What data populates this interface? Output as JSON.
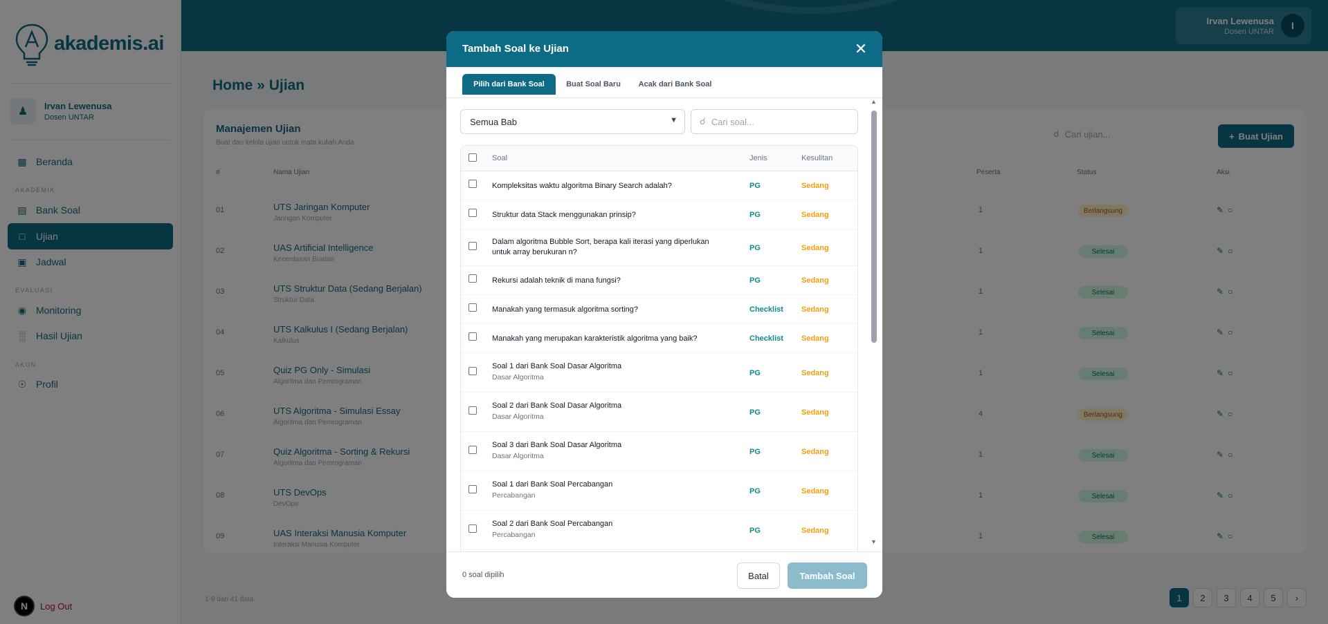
{
  "brand": {
    "name": "akademis.ai"
  },
  "sidebar": {
    "user": {
      "name": "Irvan Lewenusa",
      "role": "Dosen UNTAR"
    },
    "items": [
      {
        "label": "Beranda",
        "icon": "grid-icon"
      },
      {
        "section": "AKADEMIK"
      },
      {
        "label": "Bank Soal",
        "icon": "book-icon"
      },
      {
        "label": "Ujian",
        "icon": "clipboard-icon",
        "active": true
      },
      {
        "label": "Jadwal",
        "icon": "calendar-icon"
      },
      {
        "section": "EVALUASI"
      },
      {
        "label": "Monitoring",
        "icon": "eye-icon"
      },
      {
        "label": "Hasil Ujian",
        "icon": "bar-chart-icon"
      },
      {
        "section": "AKUN"
      },
      {
        "label": "Profil",
        "icon": "user-circle-icon"
      }
    ],
    "logout": "Log Out",
    "dev_badge": "N"
  },
  "topbar": {
    "user_name": "Irvan Lewenusa",
    "user_role": "Dosen UNTAR",
    "avatar_initial": "I"
  },
  "page": {
    "breadcrumb": "Home » Ujian",
    "card_title": "Manajemen Ujian",
    "card_subtitle": "Buat dan kelola ujian untuk mata kuliah Anda",
    "search_placeholder": "Cari ujian...",
    "create_button": "Buat Ujian",
    "columns": [
      "#",
      "Nama Ujian",
      "Peserta",
      "Status",
      "Aksi"
    ],
    "rows": [
      {
        "num": "01",
        "name": "UTS Jaringan Komputer",
        "course": "Jaringan Komputer",
        "peserta": "1",
        "status": "Berlangsung"
      },
      {
        "num": "02",
        "name": "UAS Artificial Intelligence",
        "course": "Kecerdasan Buatan",
        "peserta": "1",
        "status": "Selesai"
      },
      {
        "num": "03",
        "name": "UTS Struktur Data (Sedang Berjalan)",
        "course": "Struktur Data",
        "peserta": "1",
        "status": "Selesai"
      },
      {
        "num": "04",
        "name": "UTS Kalkulus I (Sedang Berjalan)",
        "course": "Kalkulus",
        "peserta": "1",
        "status": "Selesai"
      },
      {
        "num": "05",
        "name": "Quiz PG Only - Simulasi",
        "course": "Algoritma dan Pemrograman",
        "peserta": "1",
        "status": "Selesai"
      },
      {
        "num": "06",
        "name": "UTS Algoritma - Simulasi Essay",
        "course": "Algoritma dan Pemrograman",
        "peserta": "4",
        "status": "Berlangsung"
      },
      {
        "num": "07",
        "name": "Quiz Algoritma - Sorting & Rekursi",
        "course": "Algoritma dan Pemrograman",
        "peserta": "1",
        "status": "Selesai"
      },
      {
        "num": "08",
        "name": "UTS DevOps",
        "course": "DevOps",
        "peserta": "1",
        "status": "Selesai"
      },
      {
        "num": "09",
        "name": "UAS Interaksi Manusia Komputer",
        "course": "Interaksi Manusia Komputer",
        "peserta": "1",
        "status": "Selesai"
      }
    ],
    "footer_info": "1-9 dari 41 data",
    "pages": [
      "1",
      "2",
      "3",
      "4",
      "5",
      "›"
    ]
  },
  "modal": {
    "title": "Tambah Soal ke Ujian",
    "tabs": [
      "Pilih dari Bank Soal",
      "Buat Soal Baru",
      "Acak dari Bank Soal"
    ],
    "active_tab": 0,
    "filter_selected": "Semua Bab",
    "search_placeholder": "Cari soal...",
    "columns": {
      "soal": "Soal",
      "jenis": "Jenis",
      "kesulitan": "Kesulitan"
    },
    "questions": [
      {
        "text": "Kompleksitas waktu algoritma Binary Search adalah?",
        "sub": "",
        "type": "PG",
        "difficulty": "Sedang"
      },
      {
        "text": "Struktur data Stack menggunakan prinsip?",
        "sub": "",
        "type": "PG",
        "difficulty": "Sedang"
      },
      {
        "text": "Dalam algoritma Bubble Sort, berapa kali iterasi yang diperlukan untuk array berukuran n?",
        "sub": "",
        "type": "PG",
        "difficulty": "Sedang"
      },
      {
        "text": "Rekursi adalah teknik di mana fungsi?",
        "sub": "",
        "type": "PG",
        "difficulty": "Sedang"
      },
      {
        "text": "Manakah yang termasuk algoritma sorting?",
        "sub": "",
        "type": "Checklist",
        "difficulty": "Sedang"
      },
      {
        "text": "Manakah yang merupakan karakteristik algoritma yang baik?",
        "sub": "",
        "type": "Checklist",
        "difficulty": "Sedang"
      },
      {
        "text": "Soal 1 dari Bank Soal Dasar Algoritma",
        "sub": "Dasar Algoritma",
        "type": "PG",
        "difficulty": "Sedang"
      },
      {
        "text": "Soal 2 dari Bank Soal Dasar Algoritma",
        "sub": "Dasar Algoritma",
        "type": "PG",
        "difficulty": "Sedang"
      },
      {
        "text": "Soal 3 dari Bank Soal Dasar Algoritma",
        "sub": "Dasar Algoritma",
        "type": "PG",
        "difficulty": "Sedang"
      },
      {
        "text": "Soal 1 dari Bank Soal Percabangan",
        "sub": "Percabangan",
        "type": "PG",
        "difficulty": "Sedang"
      },
      {
        "text": "Soal 2 dari Bank Soal Percabangan",
        "sub": "Percabangan",
        "type": "PG",
        "difficulty": "Sedang"
      }
    ],
    "selected_count": "0 soal dipilih",
    "cancel_label": "Batal",
    "submit_label": "Tambah Soal"
  },
  "colors": {
    "primary": "#0e6b85",
    "accent_type": "#0e8a8a",
    "accent_difficulty": "#f59e0b",
    "submit_disabled": "#8cbccb"
  }
}
